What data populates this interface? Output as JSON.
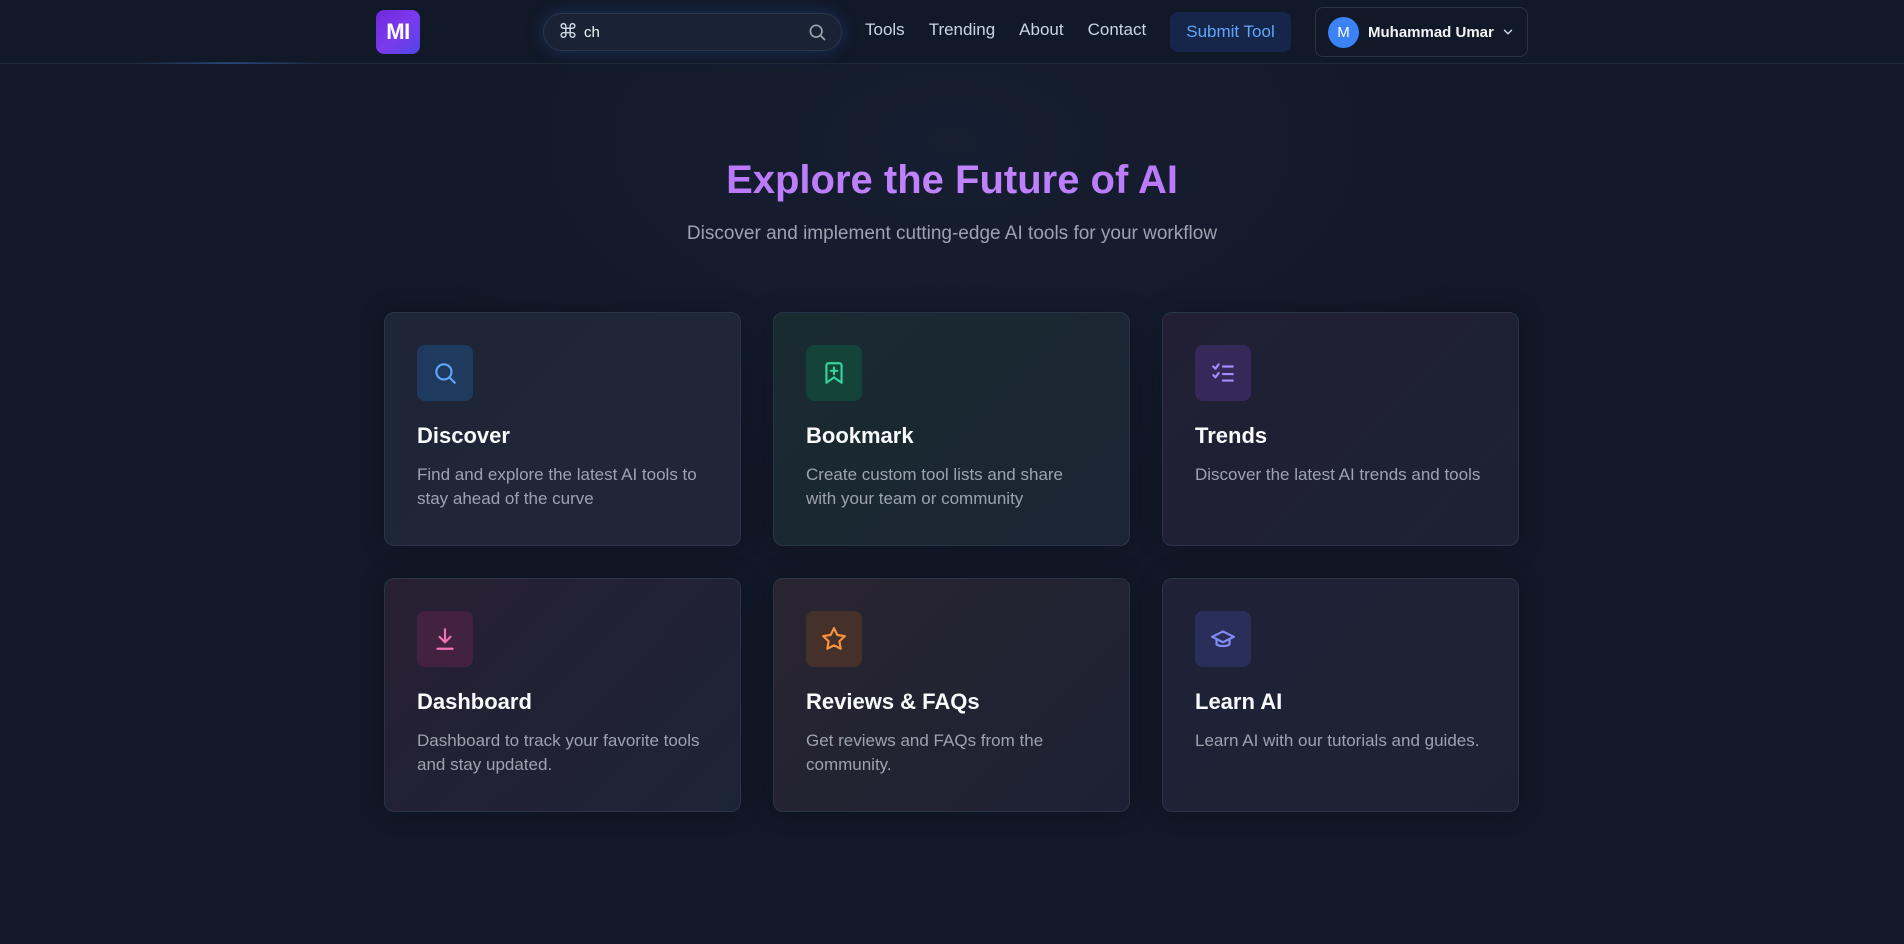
{
  "header": {
    "logo_text": "MI",
    "search": {
      "shortcut_icon": "⌘",
      "value": "ch"
    },
    "nav": [
      "Tools",
      "Trending",
      "About",
      "Contact"
    ],
    "submit_label": "Submit Tool",
    "user": {
      "initial": "M",
      "name": "Muhammad Umar"
    }
  },
  "hero": {
    "title": "Explore the Future of AI",
    "subtitle": "Discover and implement cutting-edge AI tools for your workflow"
  },
  "cards": [
    {
      "title": "Discover",
      "desc": "Find and explore the latest AI tools to stay ahead of the curve",
      "icon": "search-icon",
      "color": "#60a5fa"
    },
    {
      "title": "Bookmark",
      "desc": "Create custom tool lists and share with your team or community",
      "icon": "bookmark-plus-icon",
      "color": "#34d399"
    },
    {
      "title": "Trends",
      "desc": "Discover the latest AI trends and tools",
      "icon": "list-checks-icon",
      "color": "#a78bfa"
    },
    {
      "title": "Dashboard",
      "desc": "Dashboard to track your favorite tools and stay updated.",
      "icon": "download-icon",
      "color": "#f472b6"
    },
    {
      "title": "Reviews & FAQs",
      "desc": "Get reviews and FAQs from the community.",
      "icon": "star-icon",
      "color": "#fb923c"
    },
    {
      "title": "Learn AI",
      "desc": "Learn AI with our tutorials and guides.",
      "icon": "graduation-cap-icon",
      "color": "#818cf8"
    }
  ],
  "colors": {
    "background": "#111827",
    "accent_purple": "#a855f7",
    "accent_blue": "#3b82f6"
  }
}
